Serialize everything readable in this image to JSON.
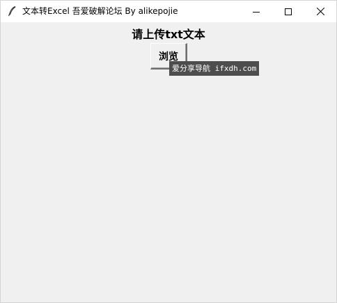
{
  "window": {
    "title": "文本转Excel 吾爱破解论坛 By alikepojie",
    "icon": "feather-icon",
    "controls": {
      "minimize_icon": "minimize-icon",
      "maximize_icon": "maximize-icon",
      "close_icon": "close-icon"
    }
  },
  "main": {
    "heading": "请上传txt文本",
    "browse_label": "浏览"
  },
  "watermark": {
    "text": "爱分享导航 ifxdh.com"
  },
  "colors": {
    "titlebar_bg": "#ffffff",
    "client_bg": "#f0f0f0",
    "watermark_bg": "#4d4d4d"
  }
}
